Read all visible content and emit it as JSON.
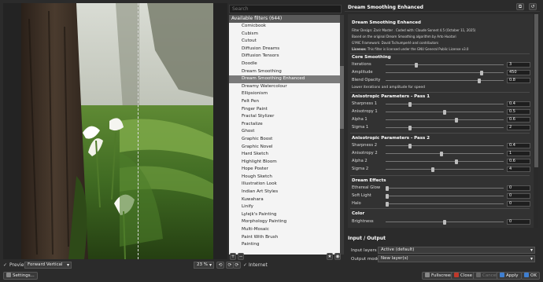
{
  "preview": {
    "label": "Preview",
    "mode": "Forward Vertical",
    "zoom": "23 %",
    "settings_label": "Settings..."
  },
  "filters": {
    "search_placeholder": "Search",
    "header": "Available filters (644)",
    "items": [
      "Comicbook",
      "Cubism",
      "Cutout",
      "Diffusion Dreams",
      "Diffusion Tensors",
      "Doodle",
      "Dream Smoothing",
      "Dream Smoothing Enhanced",
      "Dreamy Watercolour",
      "Ellipsionism",
      "Felt Pen",
      "Finger Paint",
      "Fractal Stylizer",
      "Fractalize",
      "Ghost",
      "Graphic Boost",
      "Graphic Novel",
      "Hard Sketch",
      "Highlight Bloom",
      "Hope Poster",
      "Hough Sketch",
      "Illustration Look",
      "Indian Art Styles",
      "Kuwahara",
      "Linify",
      "Lylejk's Painting",
      "Morphology Painting",
      "Multi-Mosaic",
      "Paint With Brush",
      "Painting"
    ],
    "selected_index": 7,
    "internet_label": "Internet"
  },
  "filter_panel": {
    "title": "Dream Smoothing Enhanced",
    "info_title": "Dream Smoothing Enhanced",
    "info_lines": [
      "Filter Design: Zarir Master . Coded with: Claude Sonnet 4.5 (October 11, 2025)",
      "Based on the original Dream Smoothing algorithm by Arto Huotari",
      "G'MIC Framework: David Tschumperlé and contributors"
    ],
    "license_label": "License:",
    "license_text": "This filter is licensed under the GNU General Public License v3.0",
    "core_title": "Core Smoothing",
    "core_params": [
      {
        "label": "Iterations",
        "value": "3",
        "fraction": 0.25
      },
      {
        "label": "Amplitude",
        "value": "450",
        "fraction": 0.82
      },
      {
        "label": "Blend Opacity",
        "value": "0.8",
        "fraction": 0.8
      }
    ],
    "core_note": "Lower iterations and amplitude for speed",
    "aniso1_title": "Anisotropic Parameters - Pass 1",
    "aniso1_params": [
      {
        "label": "Sharpness 1",
        "value": "0.4",
        "fraction": 0.2
      },
      {
        "label": "Anisotropy 1",
        "value": "0.5",
        "fraction": 0.5
      },
      {
        "label": "Alpha 1",
        "value": "0.6",
        "fraction": 0.6
      },
      {
        "label": "Sigma 1",
        "value": "2",
        "fraction": 0.2
      }
    ],
    "aniso2_title": "Anisotropic Parameters - Pass 2",
    "aniso2_params": [
      {
        "label": "Sharpness 2",
        "value": "0.4",
        "fraction": 0.2
      },
      {
        "label": "Anisotropy 2",
        "value": "1",
        "fraction": 0.47
      },
      {
        "label": "Alpha 2",
        "value": "0.6",
        "fraction": 0.6
      },
      {
        "label": "Sigma 2",
        "value": "4",
        "fraction": 0.4
      }
    ],
    "effects_title": "Dream Effects",
    "effects_params": [
      {
        "label": "Ethereal Glow",
        "value": "0",
        "fraction": 0
      },
      {
        "label": "Soft Light",
        "value": "0",
        "fraction": 0
      },
      {
        "label": "Halo",
        "value": "0",
        "fraction": 0
      }
    ],
    "color_title": "Color",
    "color_params": [
      {
        "label": "Brightness",
        "value": "0",
        "fraction": 0.5
      }
    ]
  },
  "io": {
    "title": "Input / Output",
    "input_label": "Input layers",
    "input_value": "Active (default)",
    "output_label": "Output mode",
    "output_value": "New layer(s)"
  },
  "buttons": {
    "fullscreen": "Fullscreen",
    "close": "Close",
    "cancel": "Cancel",
    "apply": "Apply",
    "ok": "OK"
  },
  "colors": {
    "accent_blue": "#3f7fd0",
    "close_red": "#c0392b",
    "selection_gray": "#7a7a7a"
  }
}
